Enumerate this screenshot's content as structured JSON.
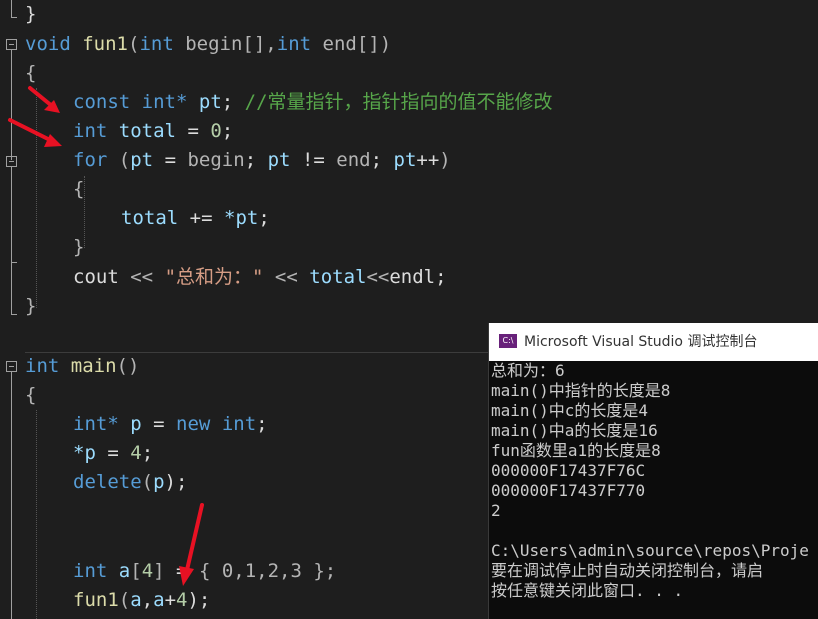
{
  "editor": {
    "lines": {
      "l0": "}",
      "l1_kw": "void",
      "l1_fn": "fun1",
      "l1_p1": "(",
      "l1_t1": "int",
      "l1_v1": "begin",
      "l1_p2": "[],",
      "l1_t2": "int",
      "l1_v2": "end",
      "l1_p3": "[])",
      "l2": "{",
      "l3_kw": "const",
      "l3_t": "int*",
      "l3_v": "pt",
      "l3_semi": ";",
      "l3_cmt": "//常量指针，指针指向的值不能修改",
      "l4_t": "int",
      "l4_v": "total",
      "l4_op": "=",
      "l4_n": "0",
      "l4_semi": ";",
      "l5_kw": "for",
      "l5_p1": "(",
      "l5_v1": "pt",
      "l5_op1": "=",
      "l5_v2": "begin",
      "l5_semi1": ";",
      "l5_v3": "pt",
      "l5_op2": "!=",
      "l5_v4": "end",
      "l5_semi2": ";",
      "l5_v5": "pt",
      "l5_op3": "++",
      "l5_p2": ")",
      "l6": "{",
      "l7_v": "total",
      "l7_op": "+=",
      "l7_v2": "*pt",
      "l7_semi": ";",
      "l8": "}",
      "l9_v": "cout",
      "l9_op1": "<<",
      "l9_str": "\"总和为：\"",
      "l9_op2": "<<",
      "l9_v2": "total",
      "l9_op3": "<<",
      "l9_v3": "endl",
      "l9_semi": ";",
      "l10": "}",
      "m1_t": "int",
      "m1_fn": "main",
      "m1_p": "()",
      "m2": "{",
      "m3_t": "int*",
      "m3_v": "p",
      "m3_op": "=",
      "m3_kw": "new",
      "m3_t2": "int",
      "m3_semi": ";",
      "m4_v": "*p",
      "m4_op": "=",
      "m4_n": "4",
      "m4_semi": ";",
      "m5_kw": "delete",
      "m5_p1": "(",
      "m5_v": "p",
      "m5_p2": ");",
      "m6_t": "int",
      "m6_v": "a",
      "m6_b": "[",
      "m6_n": "4",
      "m6_b2": "]",
      "m6_op": "=",
      "m6_rest": "{ 0,1,2,3 };",
      "m7_fn": "fun1",
      "m7_p1": "(",
      "m7_v1": "a",
      "m7_c": ",",
      "m7_v2": "a",
      "m7_op": "+",
      "m7_n": "4",
      "m7_p2": ");"
    }
  },
  "console": {
    "icon": "C:\\",
    "title": "Microsoft Visual Studio 调试控制台",
    "lines": [
      "总和为：6",
      "main()中指针的长度是8",
      "main()中c的长度是4",
      "main()中a的长度是16",
      "fun函数里a1的长度是8",
      "000000F17437F76C",
      "000000F17437F770",
      "2",
      "",
      "C:\\Users\\admin\\source\\repos\\Proje",
      "要在调试停止时自动关闭控制台，请启",
      "按任意键关闭此窗口. . ."
    ]
  },
  "colors": {
    "background": "#1e1e1e",
    "keyword": "#569cd6",
    "function": "#dcdcaa",
    "variable": "#9cdcfe",
    "number": "#b5cea8",
    "string": "#d69d85",
    "comment": "#57a64a",
    "arrow": "#e81123"
  }
}
